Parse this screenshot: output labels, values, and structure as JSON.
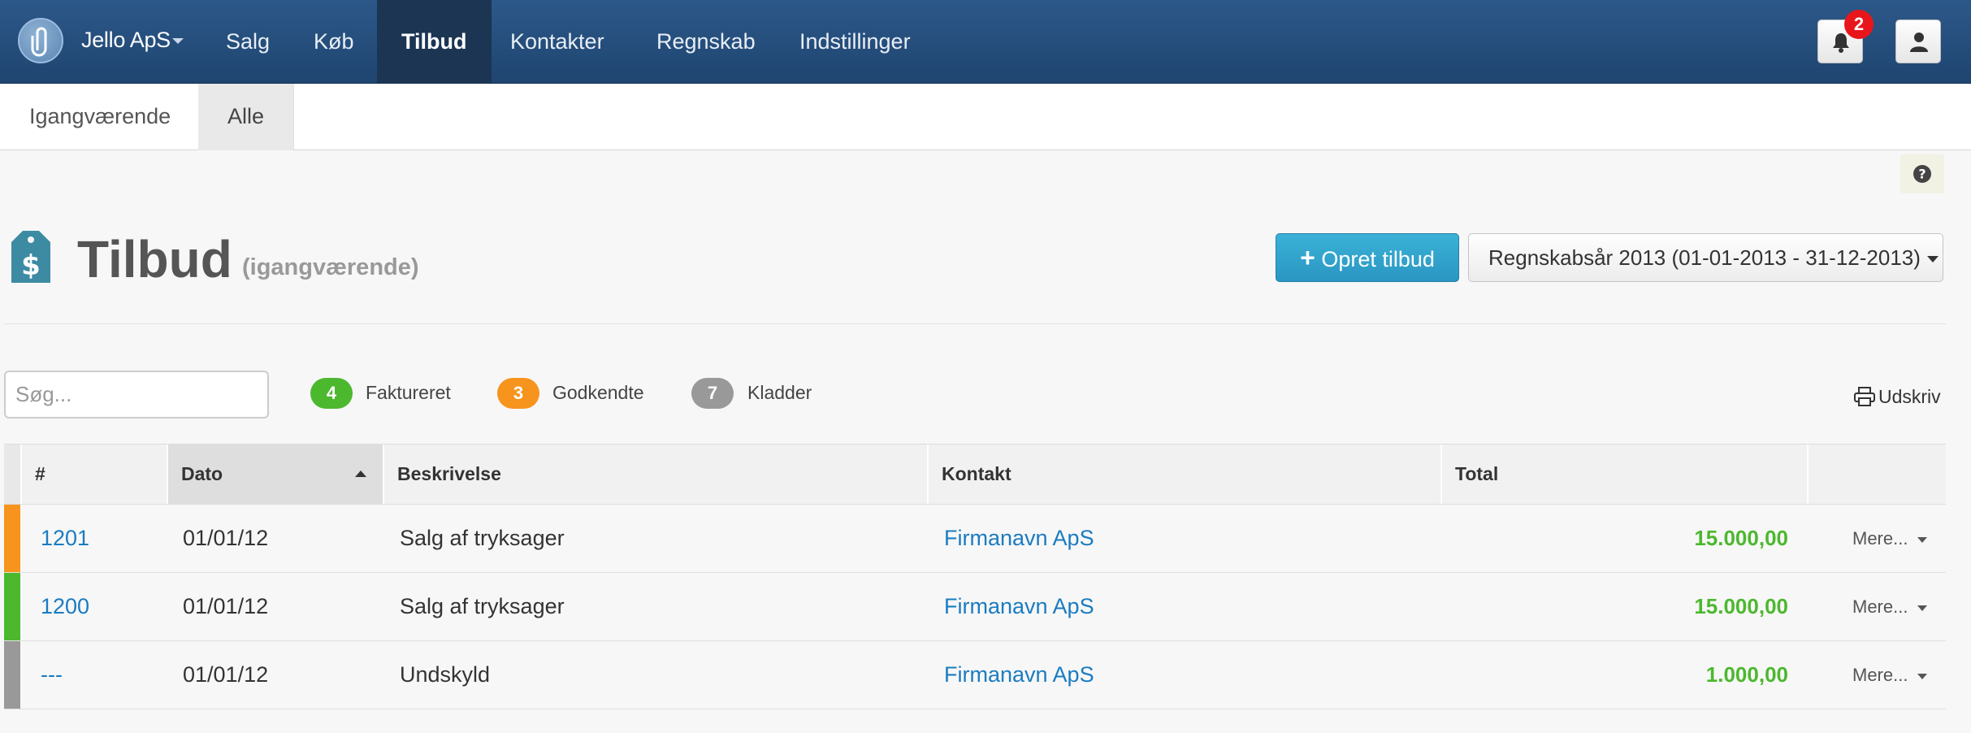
{
  "header": {
    "company": "Jello ApS",
    "nav": [
      "Salg",
      "Køb",
      "Tilbud",
      "Kontakter",
      "Regnskab",
      "Indstillinger"
    ],
    "active_nav": "Tilbud",
    "notification_count": "2"
  },
  "subnav": {
    "tabs": [
      "Igangværende",
      "Alle"
    ],
    "active": "Alle"
  },
  "page": {
    "title": "Tilbud",
    "subtitle": "(igangværende)",
    "create_label": "Opret tilbud",
    "year_label": "Regnskabsår 2013 (01-01-2013 - 31-12-2013)",
    "icon": "price-tag-dollar-icon"
  },
  "filters": {
    "search_placeholder": "Søg...",
    "counts": [
      {
        "count": "4",
        "label": "Faktureret",
        "color": "#4cb82e"
      },
      {
        "count": "3",
        "label": "Godkendte",
        "color": "#f7941d"
      },
      {
        "count": "7",
        "label": "Kladder",
        "color": "#999999"
      }
    ],
    "print_label": "Udskriv"
  },
  "table": {
    "columns": [
      "#",
      "Dato",
      "Beskrivelse",
      "Kontakt",
      "Total"
    ],
    "rows": [
      {
        "number": "1201",
        "date": "01/01/12",
        "description": "Salg af tryksager",
        "contact": "Firmanavn ApS",
        "total": "15.000,00",
        "more": "Mere...",
        "status_color": "#f7941d"
      },
      {
        "number": "1200",
        "date": "01/01/12",
        "description": "Salg af tryksager",
        "contact": "Firmanavn ApS",
        "total": "15.000,00",
        "more": "Mere...",
        "status_color": "#4cb82e"
      },
      {
        "number": "---",
        "date": "01/01/12",
        "description": "Undskyld",
        "contact": "Firmanavn ApS",
        "total": "1.000,00",
        "more": "Mere...",
        "status_color": "#999999"
      }
    ]
  }
}
